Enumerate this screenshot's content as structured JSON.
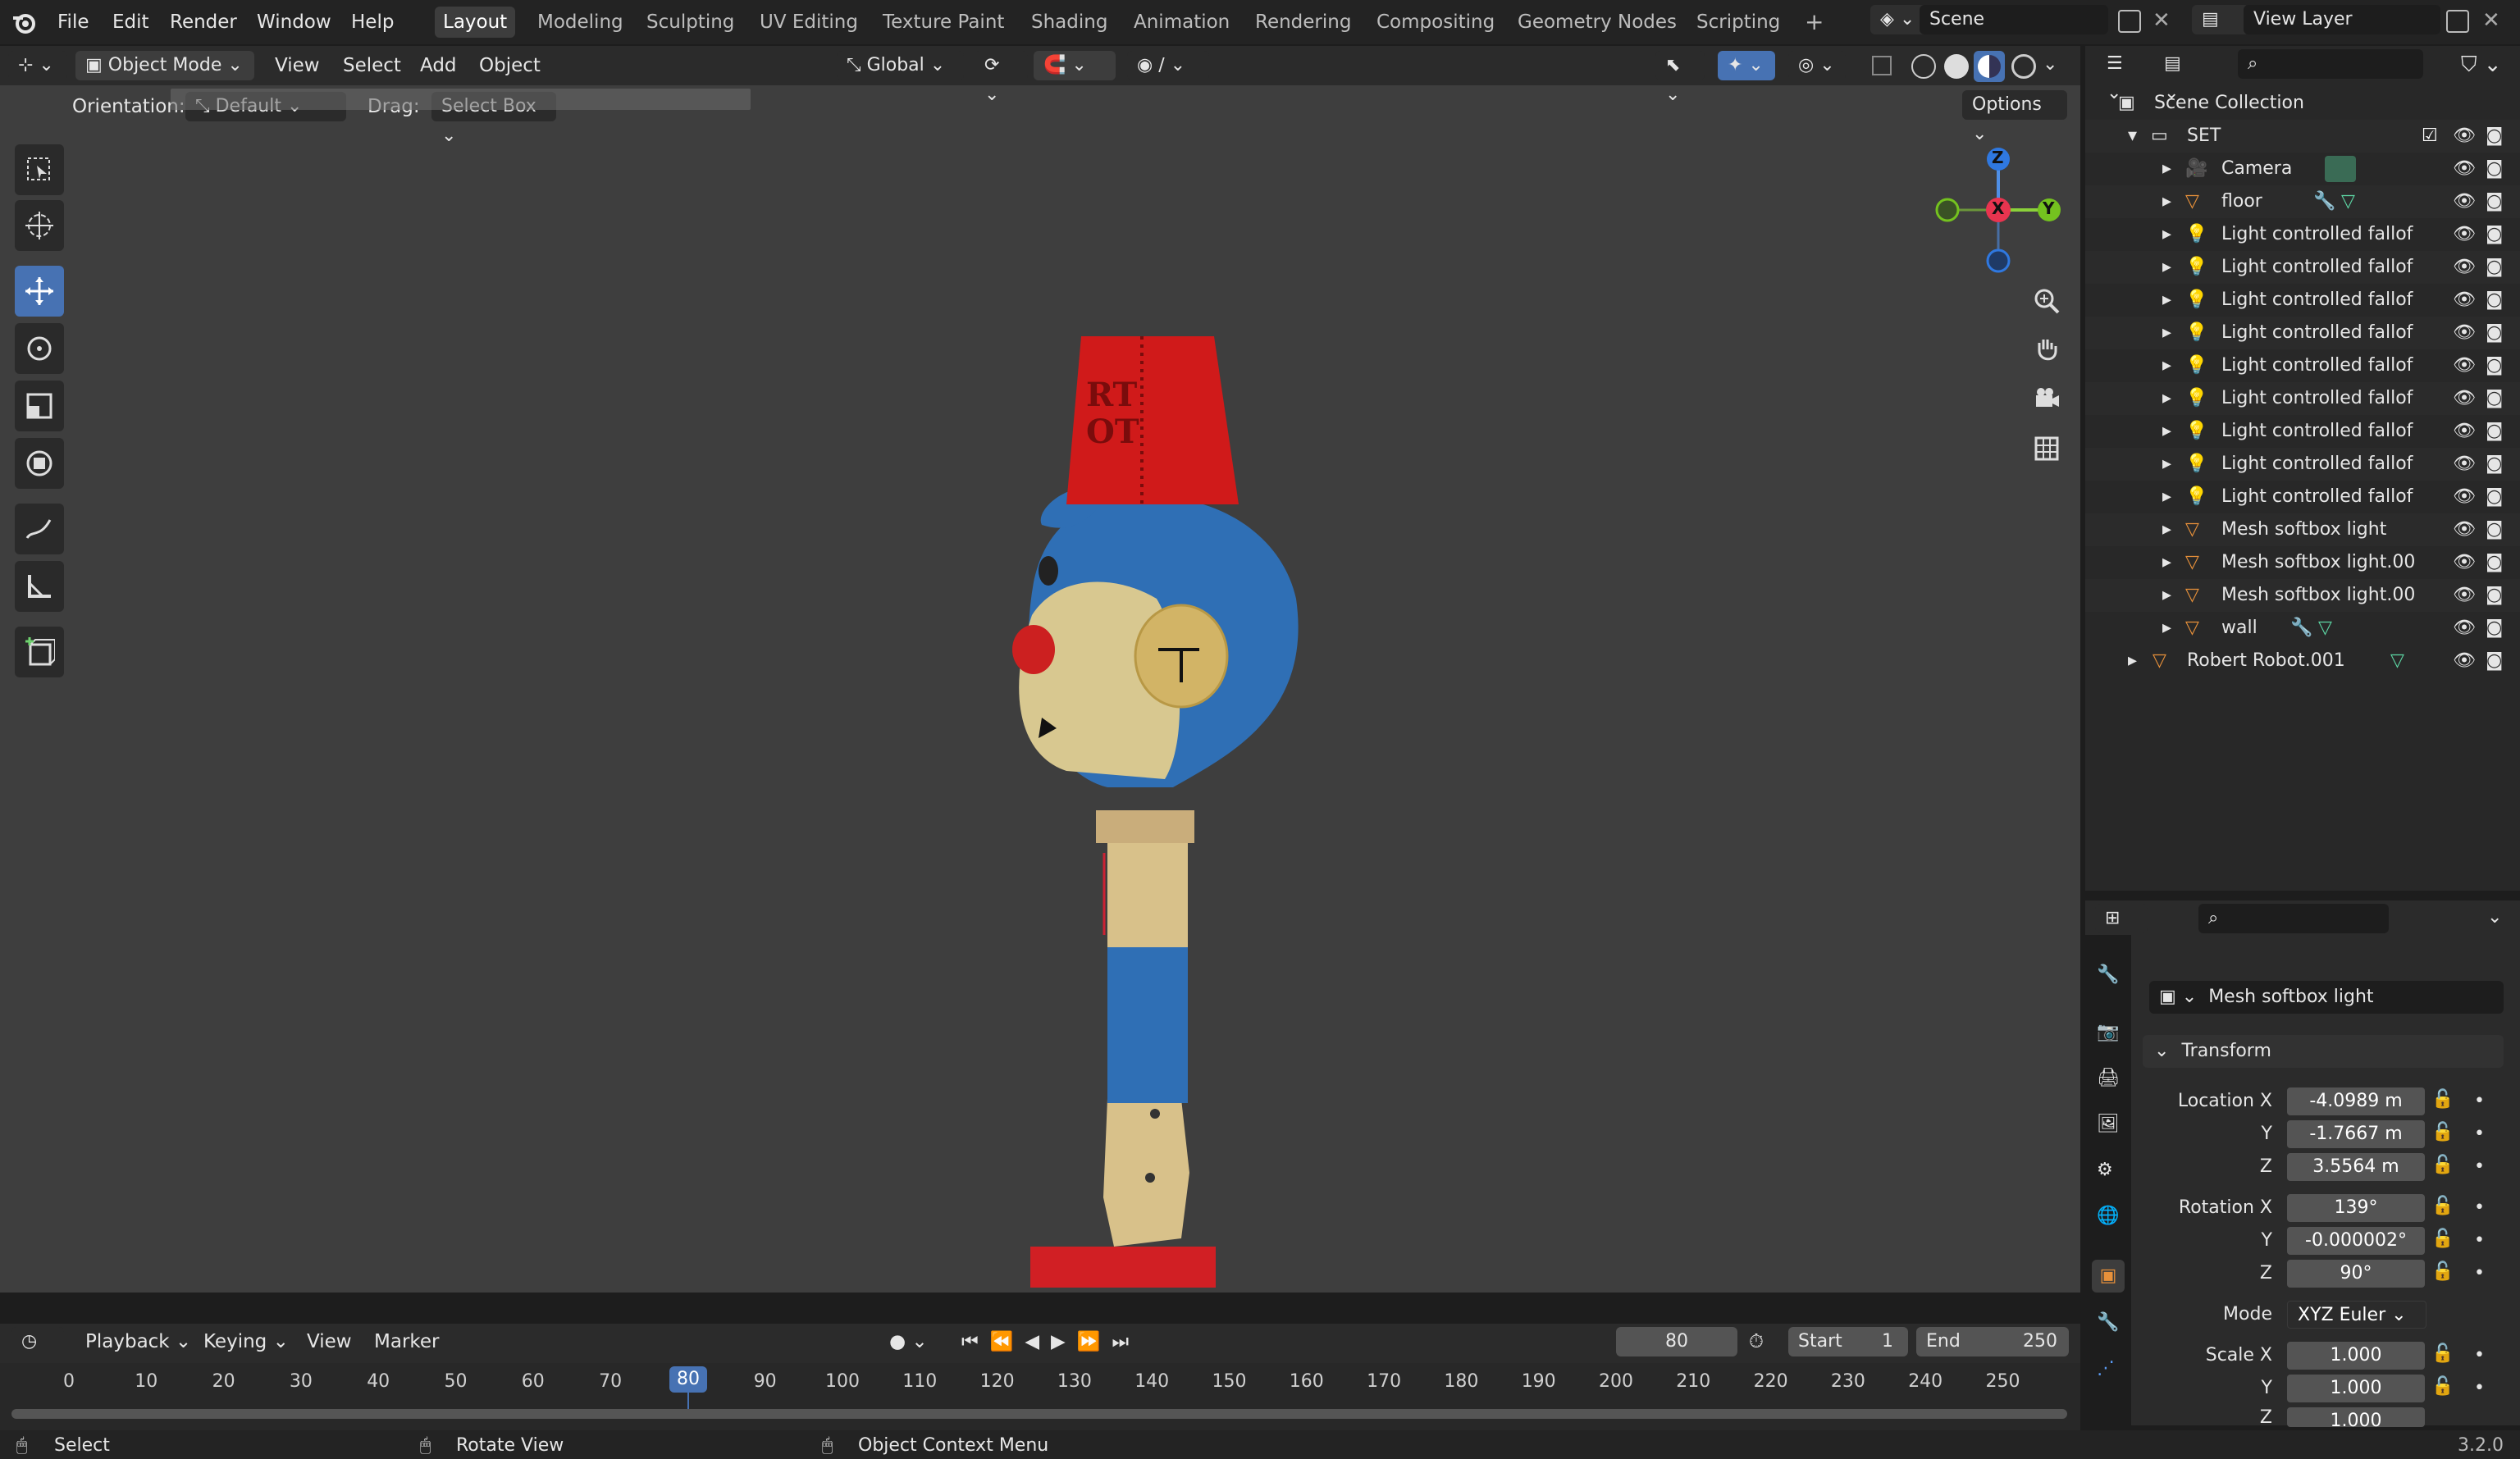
{
  "menu": {
    "items": [
      "File",
      "Edit",
      "Render",
      "Window",
      "Help"
    ]
  },
  "workspaces": [
    "Layout",
    "Modeling",
    "Sculpting",
    "UV Editing",
    "Texture Paint",
    "Shading",
    "Animation",
    "Rendering",
    "Compositing",
    "Geometry Nodes",
    "Scripting"
  ],
  "active_workspace": "Layout",
  "scene": {
    "label": "Scene"
  },
  "view_layer": {
    "label": "View Layer"
  },
  "viewport_header": {
    "mode": "Object Mode",
    "view": "View",
    "select": "Select",
    "add": "Add",
    "object": "Object",
    "transform_orientation": "Global",
    "orientation_label": "Orientation:",
    "orientation_value": "Default",
    "drag_label": "Drag:",
    "drag_value": "Select Box",
    "options": "Options"
  },
  "gizmo": {
    "z": "Z",
    "x": "X",
    "y": "Y"
  },
  "outliner": {
    "root": "Scene Collection",
    "collection": "SET",
    "items": [
      {
        "name": "Camera",
        "type": "camera"
      },
      {
        "name": "floor",
        "type": "mesh"
      },
      {
        "name": "Light controlled fallof",
        "type": "light"
      },
      {
        "name": "Light controlled fallof",
        "type": "light"
      },
      {
        "name": "Light controlled fallof",
        "type": "light"
      },
      {
        "name": "Light controlled fallof",
        "type": "light"
      },
      {
        "name": "Light controlled fallof",
        "type": "light"
      },
      {
        "name": "Light controlled fallof",
        "type": "light"
      },
      {
        "name": "Light controlled fallof",
        "type": "light"
      },
      {
        "name": "Light controlled fallof",
        "type": "light"
      },
      {
        "name": "Light controlled fallof",
        "type": "light"
      },
      {
        "name": "Mesh softbox light",
        "type": "mesh"
      },
      {
        "name": "Mesh softbox light.00",
        "type": "mesh"
      },
      {
        "name": "Mesh softbox light.00",
        "type": "mesh"
      },
      {
        "name": "wall",
        "type": "mesh"
      }
    ],
    "root_object": "Robert Robot.001"
  },
  "properties": {
    "object_name": "Mesh softbox light",
    "panel": "Transform",
    "location_label": "Location X",
    "location": {
      "x": "-4.0989 m",
      "y": "-1.7667 m",
      "z": "3.5564 m"
    },
    "rotation_label": "Rotation X",
    "rotation": {
      "x": "139°",
      "y": "-0.000002°",
      "z": "90°"
    },
    "mode_label": "Mode",
    "mode_value": "XYZ Euler",
    "scale_label": "Scale X",
    "scale": {
      "x": "1.000",
      "y": "1.000",
      "z": "1.000"
    },
    "y": "Y",
    "z": "Z"
  },
  "timeline": {
    "playback": "Playback",
    "keying": "Keying",
    "view": "View",
    "marker": "Marker",
    "current_frame": "80",
    "start_label": "Start",
    "start": "1",
    "end_label": "End",
    "end": "250",
    "ticks": [
      "0",
      "10",
      "20",
      "30",
      "40",
      "50",
      "60",
      "70",
      "80",
      "90",
      "100",
      "110",
      "120",
      "130",
      "140",
      "150",
      "160",
      "170",
      "180",
      "190",
      "200",
      "210",
      "220",
      "230",
      "240",
      "250"
    ]
  },
  "statusbar": {
    "select": "Select",
    "rotate": "Rotate View",
    "context": "Object Context Menu",
    "version": "3.2.0"
  },
  "colors": {
    "accent": "#4772b3",
    "hat": "#c81a1a",
    "body_blue": "#2f6fb5",
    "skin": "#d9c58e"
  }
}
